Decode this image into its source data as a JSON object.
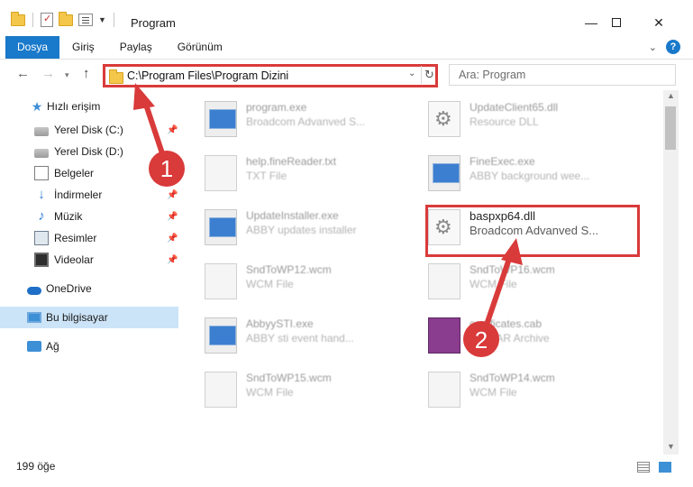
{
  "window": {
    "title": "Program",
    "minimize": "—",
    "close": "✕"
  },
  "ribbon": {
    "tabs": [
      {
        "label": "Dosya"
      },
      {
        "label": "Giriş"
      },
      {
        "label": "Paylaş"
      },
      {
        "label": "Görünüm"
      }
    ],
    "help": "?"
  },
  "nav": {
    "address_path": "C:\\Program Files\\Program Dizini",
    "search_placeholder": "Ara: Program"
  },
  "sidebar": {
    "items": [
      {
        "label": "Hızlı erişim",
        "icon": "star-icon"
      },
      {
        "label": "Yerel Disk (C:)",
        "icon": "disk-icon",
        "pinned": true
      },
      {
        "label": "Yerel Disk (D:)",
        "icon": "disk-icon",
        "pinned": true
      },
      {
        "label": "Belgeler",
        "icon": "documents-icon",
        "pinned": true
      },
      {
        "label": "İndirmeler",
        "icon": "download-icon",
        "pinned": true
      },
      {
        "label": "Müzik",
        "icon": "music-icon",
        "pinned": true
      },
      {
        "label": "Resimler",
        "icon": "pictures-icon",
        "pinned": true
      },
      {
        "label": "Videolar",
        "icon": "videos-icon",
        "pinned": true
      },
      {
        "label": "OneDrive",
        "icon": "onedrive-icon"
      },
      {
        "label": "Bu bilgisayar",
        "icon": "computer-icon",
        "selected": true
      },
      {
        "label": "Ağ",
        "icon": "network-icon"
      }
    ]
  },
  "files": [
    {
      "name": "program.exe",
      "desc": "Broadcom Advanved S...",
      "icon": "exe-icon"
    },
    {
      "name": "UpdateClient65.dll",
      "desc": "Resource DLL",
      "icon": "dll-icon"
    },
    {
      "name": "help.fineReader.txt",
      "desc": "TXT File",
      "icon": "text-file-icon"
    },
    {
      "name": "FineExec.exe",
      "desc": "ABBY background wee...",
      "icon": "exe-icon"
    },
    {
      "name": "UpdateInstaller.exe",
      "desc": "ABBY updates installer",
      "icon": "exe-icon"
    },
    {
      "name": "baspxp64.dll",
      "desc": "Broadcom Advanved S...",
      "icon": "dll-gear-icon",
      "highlighted": true
    },
    {
      "name": "SndToWP12.wcm",
      "desc": "WCM File",
      "icon": "file-icon"
    },
    {
      "name": "SndToWP16.wcm",
      "desc": "WCM File",
      "icon": "file-icon"
    },
    {
      "name": "AbbyySTI.exe",
      "desc": "ABBY sti event hand...",
      "icon": "exe-icon"
    },
    {
      "name": "certificates.cab",
      "desc": "WinRAR Archive",
      "icon": "rar-icon"
    },
    {
      "name": "SndToWP15.wcm",
      "desc": "WCM File",
      "icon": "file-icon"
    },
    {
      "name": "SndToWP14.wcm",
      "desc": "WCM File",
      "icon": "file-icon"
    }
  ],
  "annotations": {
    "step1": "1",
    "step2": "2",
    "color": "#d93a3a"
  },
  "status": {
    "item_count": "199 öğe"
  }
}
